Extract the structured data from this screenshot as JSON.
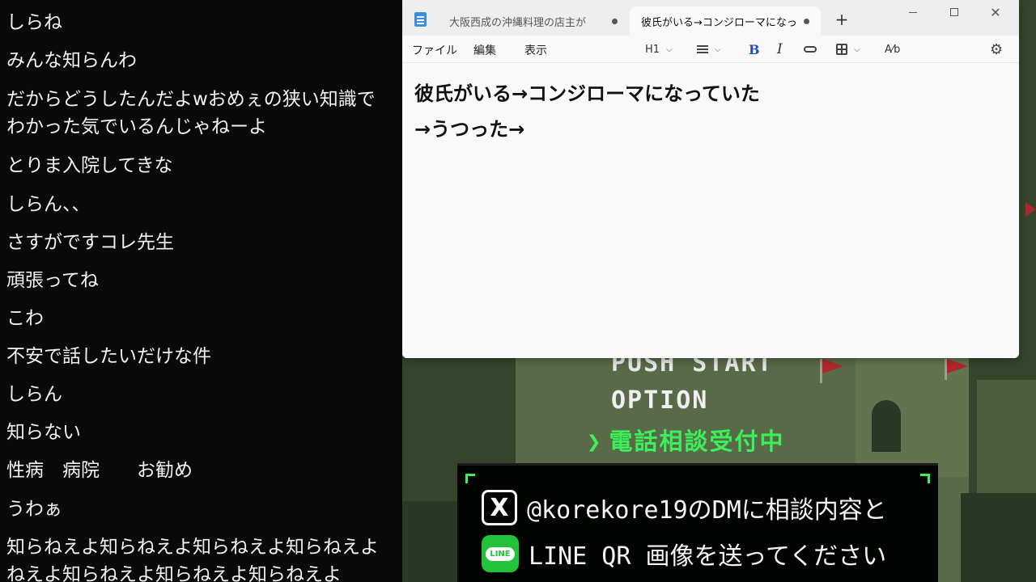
{
  "chat": {
    "lines": [
      {
        "text": "しらね"
      },
      {
        "text": "みんな知らんわ"
      },
      {
        "text": "だからどうしたんだよwおめぇの狭い知識で"
      },
      {
        "text": "わかった気でいるんじゃねーよ"
      },
      {
        "text": "とりま入院してきな"
      },
      {
        "text": "しらん、、"
      },
      {
        "text": "さすがですコレ先生"
      },
      {
        "text": "頑張ってね"
      },
      {
        "text": "こわ"
      },
      {
        "text": "不安で話したいだけな件"
      },
      {
        "text": "しらん"
      },
      {
        "text": "知らない"
      },
      {
        "text": "性病　病院　　お勧め"
      },
      {
        "text": "うわぁ"
      },
      {
        "text": "知らねえよ知らねえよ知らねえよ知らねえよ"
      },
      {
        "text": "ねえよ知らねえよ知らねえよ知らねえよ"
      }
    ]
  },
  "notepad": {
    "tabs": [
      {
        "label": "大阪西成の沖縄料理の店主が",
        "active": false
      },
      {
        "label": "彼氏がいる→コンジローマになってい",
        "active": true
      }
    ],
    "new_tab_label": "+",
    "menu": {
      "file": "ファイル",
      "edit": "編集",
      "view": "表示"
    },
    "toolbar": {
      "heading": "H1",
      "bold": "B",
      "italic": "I"
    },
    "document": {
      "lines": [
        "彼氏がいる→コンジローマになっていた",
        "→うつった→"
      ]
    }
  },
  "game": {
    "push_start": "PUSH START",
    "option": "OPTION",
    "phone_caret": "❯",
    "phone_text": "電話相談受付中",
    "x_logo": "X",
    "x_text": "@korekore19のDMに相談内容と",
    "line_logo": "LINE",
    "line_text": "LINE QR 画像を送ってください",
    "accent_color": "#3cf05a",
    "flag_color": "#b0262c"
  }
}
